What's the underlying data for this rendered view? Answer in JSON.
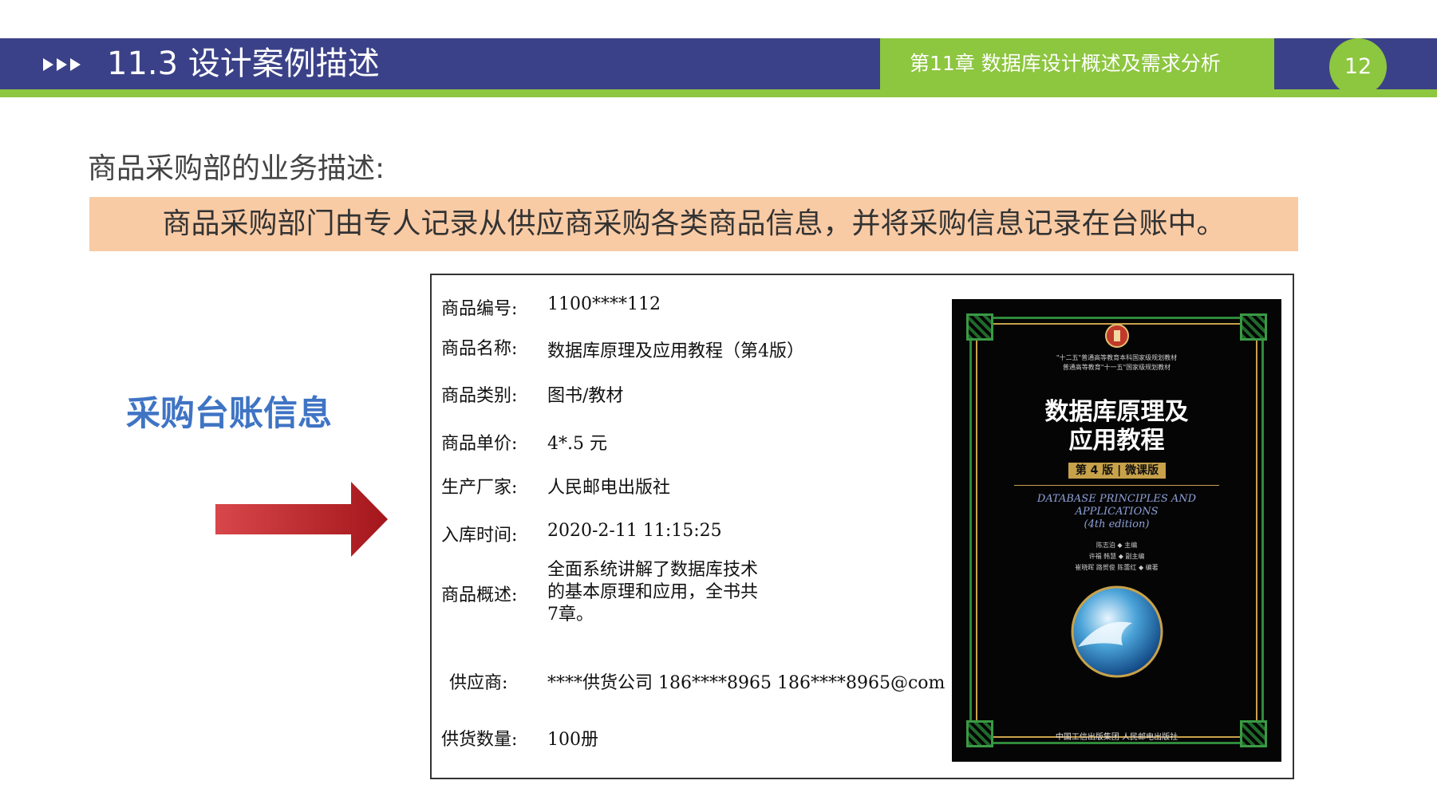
{
  "header": {
    "section_title": "11.3  设计案例描述",
    "chapter_label": "第11章   数据库设计概述及需求分析",
    "page_number": "12",
    "colors": {
      "bar": "#3b4188",
      "accent": "#8dc63f"
    }
  },
  "main": {
    "subtitle": "商品采购部的业务描述:",
    "description": "商品采购部门由专人记录从供应商采购各类商品信息，并将采购信息记录在台账中。",
    "ledger_title": "采购台账信息",
    "arrow_icon": "right-arrow-icon"
  },
  "record": {
    "fields": [
      {
        "label": "商品编号:",
        "value": "1100****112"
      },
      {
        "label": "商品名称:",
        "value": "数据库原理及应用教程（第4版）"
      },
      {
        "label": "商品类别:",
        "value": "图书/教材"
      },
      {
        "label": "商品单价:",
        "value": "4*.5 元"
      },
      {
        "label": "生产厂家:",
        "value": "人民邮电出版社"
      },
      {
        "label": "入库时间:",
        "value": "2020-2-11 11:15:25"
      },
      {
        "label": "商品概述:",
        "value": "全面系统讲解了数据库技术的基本原理和应用，全书共7章。"
      },
      {
        "label": "供应商:",
        "value": "****供货公司 186****8965 186****8965@com"
      },
      {
        "label": "供货数量:",
        "value": "100册"
      }
    ]
  },
  "cover": {
    "series_line1": "\"十二五\"普通高等教育本科国家级规划教材",
    "series_line2": "普通高等教育\"十一五\"国家级规划教材",
    "title_line1": "数据库原理及",
    "title_line2": "应用教程",
    "edition": "第 4 版 | 微课版",
    "english_line1": "DATABASE PRINCIPLES AND",
    "english_line2": "APPLICATIONS",
    "english_line3": "(4th edition)",
    "author1": "陈志泊 ◆ 主编",
    "author2": "许福 韩慧 ◆ 副主编",
    "author3": "崔晓晖 路贺俊 陈蕾红 ◆ 编著",
    "publisher": "中国工信出版集团   人民邮电出版社"
  }
}
